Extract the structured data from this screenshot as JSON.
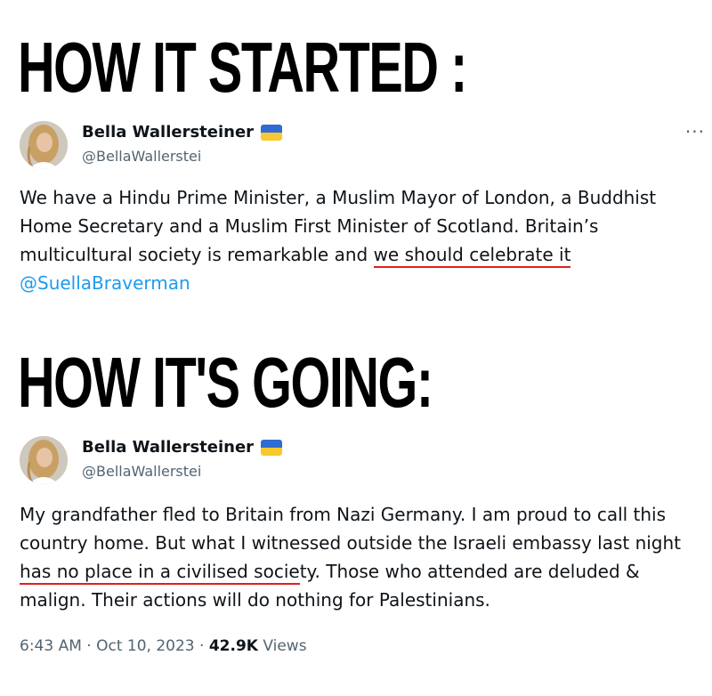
{
  "headings": {
    "started": "HOW IT STARTED :",
    "going": "HOW IT'S GOING:"
  },
  "tweet1": {
    "author": "Bella Wallersteiner",
    "handle": "@BellaWallerstei",
    "flag_emoji": "ukraine-flag",
    "more_label": "···",
    "text_before": "We have a Hindu Prime Minister, a Muslim Mayor of London, a Buddhist Home Secretary and a Muslim First Minister of Scotland. Britain’s multicultural society is remarkable and ",
    "text_underlined": "we should celebrate it",
    "mention": "@SuellaBraverman"
  },
  "tweet2": {
    "author": "Bella Wallersteiner",
    "handle": "@BellaWallerstei",
    "flag_emoji": "ukraine-flag",
    "text_before": "My grandfather fled to Britain from Nazi Germany. I am proud to call this country home. But what I witnessed outside the Israeli embassy last night ",
    "text_underlined": "has no place in a civilised socie",
    "text_after": "ty. Those who attended are deluded & malign. Their actions will do nothing for Palestinians.",
    "time": "6:43 AM",
    "sep1": " · ",
    "date": "Oct 10, 2023",
    "sep2": " · ",
    "views_count": "42.9K",
    "views_label": " Views"
  },
  "colors": {
    "underline": "#e01e1e",
    "mention": "#1d9bf0",
    "secondary_text": "#536471",
    "flag_blue": "#2f6bd1",
    "flag_yellow": "#f7c92e"
  }
}
